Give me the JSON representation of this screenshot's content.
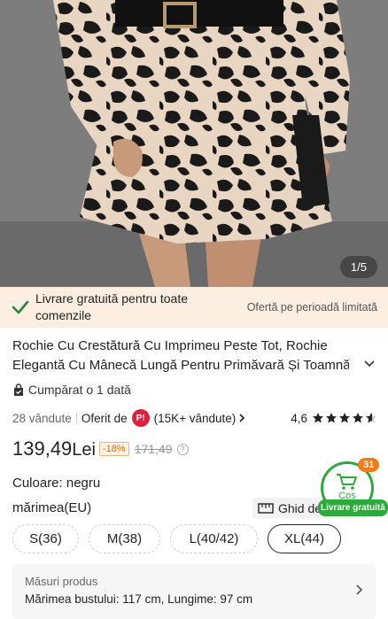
{
  "gallery": {
    "counter": "1/5"
  },
  "delivery": {
    "main": "Livrare gratuită pentru toate comenzile",
    "promo": "Ofertă pe perioadă limitată"
  },
  "product": {
    "title_line1": "Rochie Cu Crestătură Cu Imprimeu Peste Tot, Rochie",
    "title_line2": "Elegantă Cu Mânecă Lungă Pentru Primăvară Și Toamnă",
    "bought": "Cumpărat o 1 dată",
    "sold": "28 vândute",
    "offered_by": "Oferit de",
    "seller_logo": "P!",
    "seller_count": "(15K+ vândute)",
    "rating": "4,6",
    "rating_value": 4.6,
    "price": "139,49",
    "currency": "Lei",
    "discount": "-18%",
    "old_price": "171,49",
    "color_label": "Culoare: negru",
    "size_label": "mărimea(EU)",
    "size_guide": "Ghid de mărimi",
    "sizes": [
      "S(36)",
      "M(38)",
      "L(40/42)",
      "XL(44)"
    ],
    "selected_size": "XL(44)",
    "measure_title": "Măsuri produs",
    "measure_value": "Mărimea bustului: 117 cm, Lungime: 97 cm"
  },
  "cart": {
    "label": "Coș",
    "badge": "31",
    "free": "Livrare gratuită"
  },
  "colors": {
    "accent_green": "#2eaa3c",
    "badge_orange": "#f07d1a",
    "delivery_bg": "#fdeee2"
  }
}
